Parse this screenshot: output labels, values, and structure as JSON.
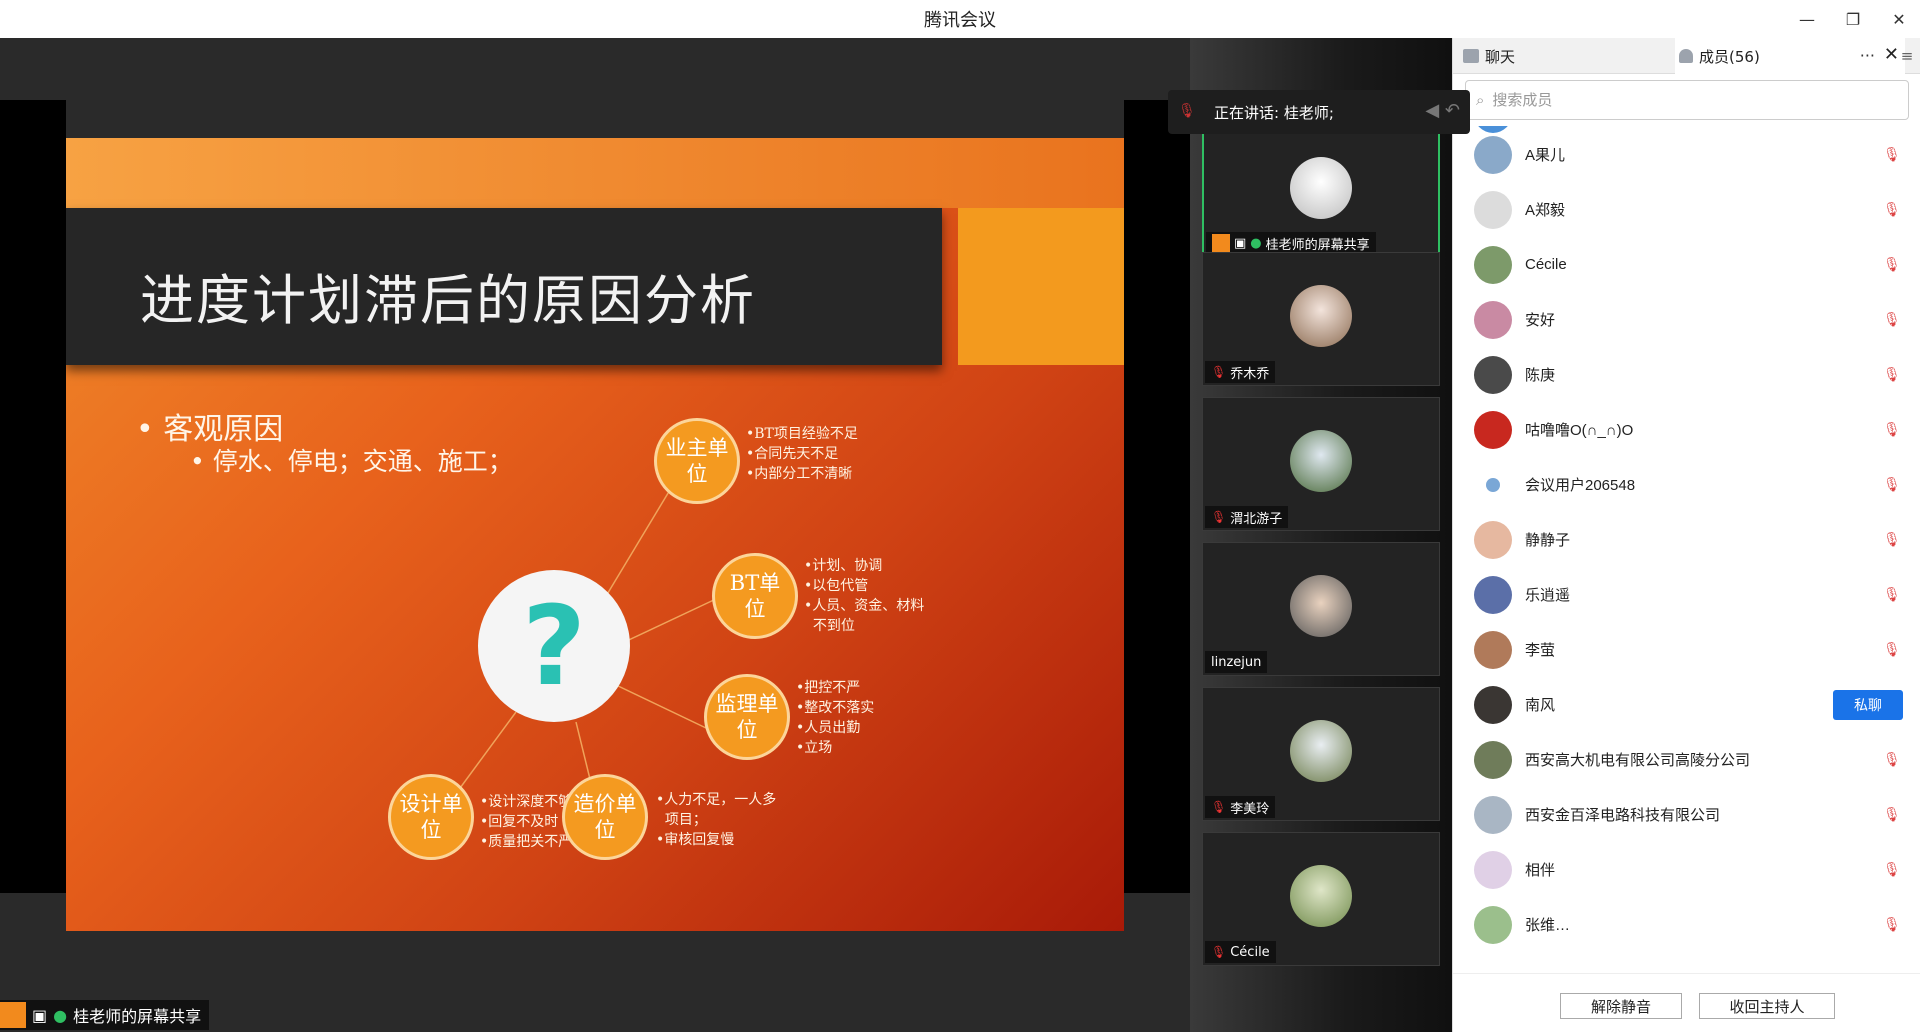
{
  "window": {
    "title": "腾讯会议"
  },
  "slide": {
    "title": "进度计划滞后的原因分析",
    "bullet_main": "客观原因",
    "bullet_sub": "停水、停电；交通、施工；",
    "nodes": [
      {
        "label": "业主单位",
        "notes": "•BT项目经验不足\n•合同先天不足\n•内部分工不清晰"
      },
      {
        "label": "BT单位",
        "notes": "•计划、协调\n•以包代管\n•人员、资金、材料\n  不到位"
      },
      {
        "label": "监理单位",
        "notes": "•把控不严\n•整改不落实\n•人员出勤\n•立场"
      },
      {
        "label": "设计单位",
        "notes": "•设计深度不够\n•回复不及时\n•质量把关不严"
      },
      {
        "label": "造价单位",
        "notes": "•人力不足，一人多\n  项目；\n•审核回复慢"
      }
    ]
  },
  "speaking": {
    "text": "正在讲话: 桂老师;"
  },
  "tiles": [
    {
      "label": "桂老师的屏幕共享",
      "active": true
    },
    {
      "label": "乔木乔"
    },
    {
      "label": "渭北游子"
    },
    {
      "label": "linzejun"
    },
    {
      "label": "李美玲"
    },
    {
      "label": "Cécile"
    }
  ],
  "panel": {
    "tab_chat": "聊天",
    "tab_members": "成员(56)",
    "more": "···",
    "close": "✕",
    "search_placeholder": "搜索成员",
    "members": [
      {
        "name": "A果儿",
        "color": "#8aa9c9"
      },
      {
        "name": "A郑毅",
        "color": "#dcdcdc"
      },
      {
        "name": "Cécile",
        "color": "#7d9a6a"
      },
      {
        "name": "安好",
        "color": "#c98aa3"
      },
      {
        "name": "陈庚",
        "color": "#4a4a4a"
      },
      {
        "name": "咕噜噜O(∩_∩)O",
        "color": "#c8281f"
      },
      {
        "name": "会议用户206548",
        "color": "#7aa7d6"
      },
      {
        "name": "静静子",
        "color": "#e6b8a0"
      },
      {
        "name": "乐逍遥",
        "color": "#5b6fa8"
      },
      {
        "name": "李萤",
        "color": "#b07a5a"
      },
      {
        "name": "南风",
        "color": "#3a3633",
        "private_chat": "私聊"
      },
      {
        "name": "西安高大机电有限公司高陵分公司",
        "color": "#6f7c5a"
      },
      {
        "name": "西安金百泽电路科技有限公司",
        "color": "#a9b6c4"
      },
      {
        "name": "相伴",
        "color": "#e0d0e6"
      },
      {
        "name": "张维…",
        "color": "#9bbf8c"
      }
    ],
    "btn_unmute": "解除静音",
    "btn_reclaim_host": "收回主持人"
  },
  "share_label": "桂老师的屏幕共享"
}
